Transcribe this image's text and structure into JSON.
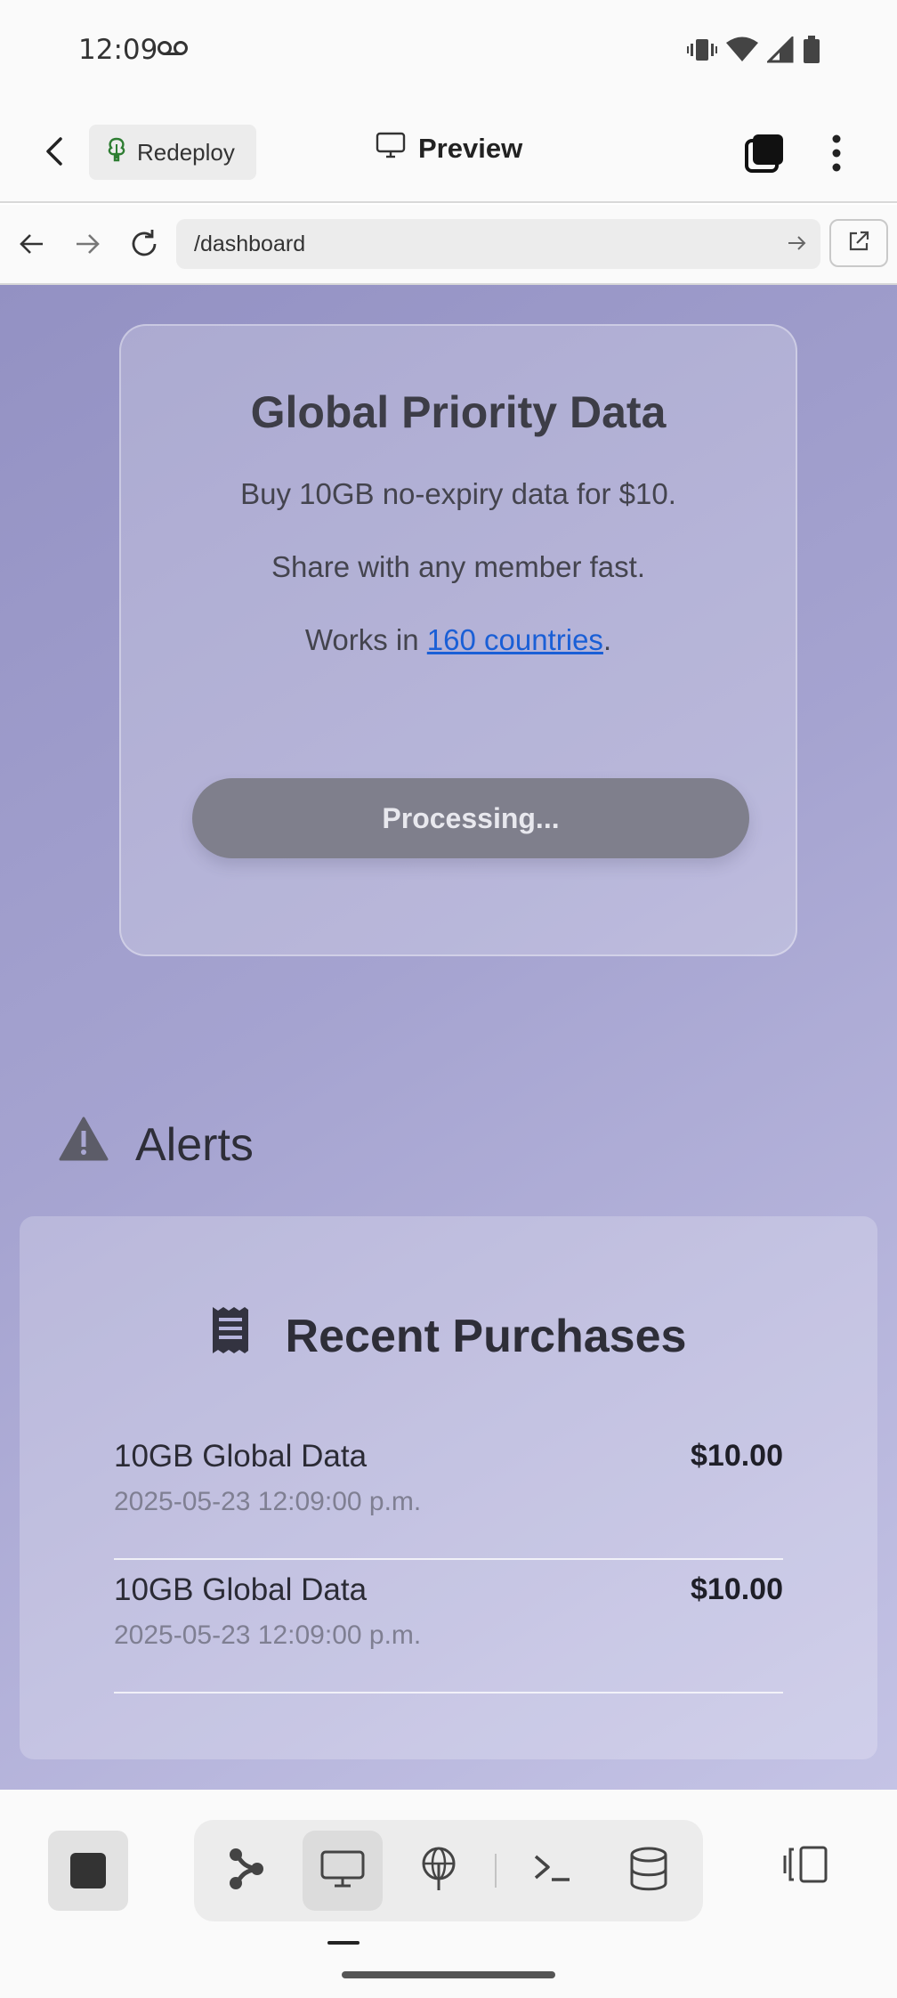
{
  "status_bar": {
    "time": "12:09"
  },
  "header": {
    "redeploy_label": "Redeploy",
    "preview_label": "Preview"
  },
  "browser": {
    "url": "/dashboard"
  },
  "promo": {
    "title": "Global Priority Data",
    "line1": "Buy 10GB no-expiry data for $10.",
    "line2": "Share with any member fast.",
    "line3_prefix": "Works in ",
    "line3_link": "160 countries",
    "line3_suffix": ".",
    "button_label": "Processing..."
  },
  "alerts": {
    "heading": "Alerts"
  },
  "purchases": {
    "title": "Recent Purchases",
    "items": [
      {
        "name": "10GB Global Data",
        "date": "2025-05-23 12:09:00 p.m.",
        "price": "$10.00"
      },
      {
        "name": "10GB Global Data",
        "date": "2025-05-23 12:09:00 p.m.",
        "price": "$10.00"
      }
    ]
  },
  "colors": {
    "link": "#1a5fd6",
    "button_processing": "#7f7f8c",
    "redeploy_icon": "#2e7d32"
  }
}
